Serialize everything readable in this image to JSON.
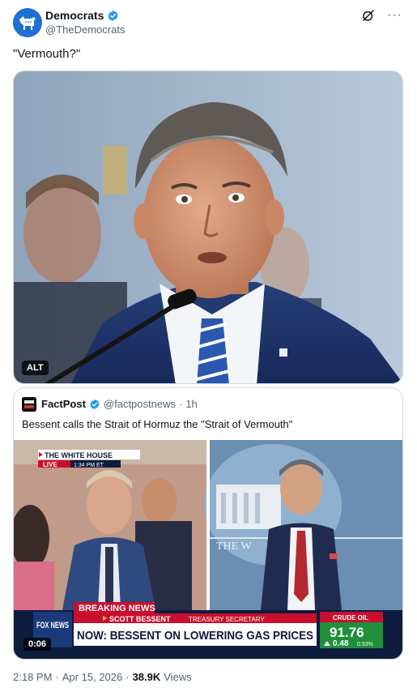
{
  "author": {
    "display_name": "Democrats",
    "handle": "@TheDemocrats",
    "avatar_icon": "donkey-logo-icon",
    "avatar_color": "#1d6fd6",
    "verified_color": "#1d9bf0"
  },
  "post": {
    "text": "\"Vermouth?\"",
    "alt_label": "ALT"
  },
  "top_actions": {
    "grok_icon": "grok-icon",
    "more_icon": "more-options-icon",
    "more_label": "···"
  },
  "quote": {
    "display_name": "FactPost",
    "handle": "@factpostnews",
    "separator": "·",
    "time": "1h",
    "text": "Bessent calls the Strait of Hormuz the \"Strait of Vermouth\"",
    "video_duration": "0:06",
    "tv": {
      "location_label": "THE WHITE HOUSE",
      "live_label": "LIVE",
      "live_time": "1:34 PM ET",
      "breaking_label": "BREAKING NEWS",
      "name_label": "SCOTT BESSENT",
      "title_label": "TREASURY SECRETARY",
      "headline": "NOW: BESSENT ON LOWERING GAS PRICES",
      "network": "FOX NEWS",
      "ticker_label": "CRUDE OIL",
      "ticker_value": "91.76",
      "ticker_change": "0.48",
      "ticker_pct": "0.53%",
      "podium_text": "THE W"
    }
  },
  "footer": {
    "time": "2:18 PM",
    "dot1": "·",
    "date": "Apr 15, 2026",
    "dot2": "·",
    "views_count": "38.9K",
    "views_label": "Views"
  }
}
